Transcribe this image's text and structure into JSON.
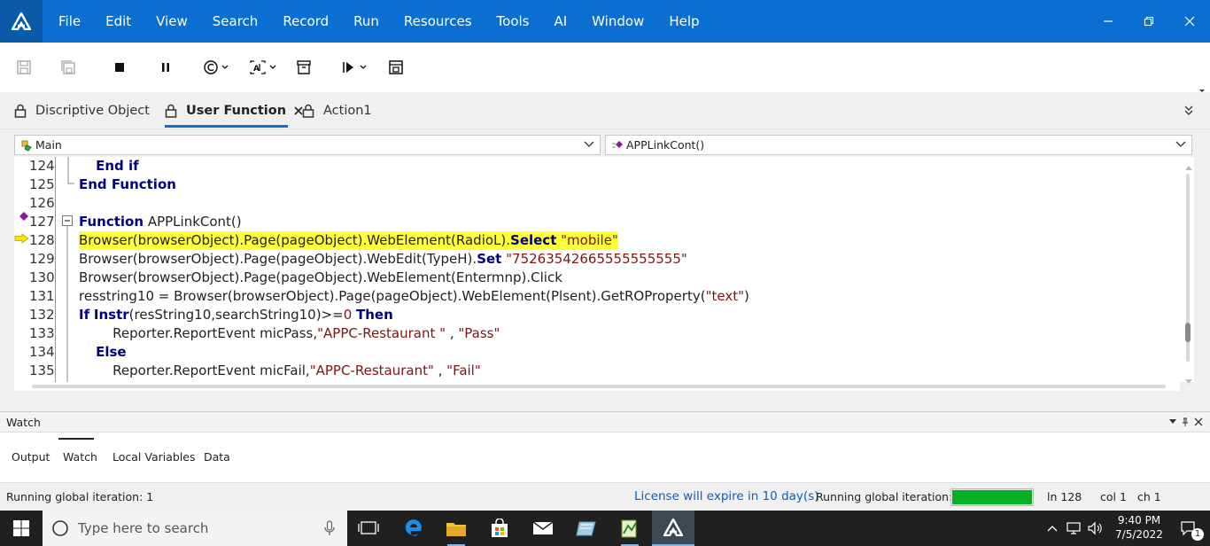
{
  "menubar": {
    "items": [
      "File",
      "Edit",
      "View",
      "Search",
      "Record",
      "Run",
      "Resources",
      "Tools",
      "AI",
      "Window",
      "Help"
    ]
  },
  "tabs": [
    {
      "label": "Discriptive Object"
    },
    {
      "label": "User Function",
      "active": true
    },
    {
      "label": "Action1"
    }
  ],
  "dropdowns": {
    "left": "Main",
    "right": "APPLinkCont()"
  },
  "code": {
    "lines": [
      {
        "num": "124",
        "segments": [
          {
            "t": "    "
          },
          {
            "t": "End if",
            "c": "kw"
          }
        ]
      },
      {
        "num": "125",
        "segments": [
          {
            "t": "End Function",
            "c": "kw"
          }
        ]
      },
      {
        "num": "126",
        "segments": []
      },
      {
        "num": "127",
        "segments": [
          {
            "t": "Function",
            "c": "kw"
          },
          {
            "t": " APPLinkCont()"
          }
        ]
      },
      {
        "num": "128",
        "highlight": true,
        "segments": [
          {
            "t": "Browser(browserObject).Page(pageObject).WebElement(RadioL)."
          },
          {
            "t": "Select",
            "c": "kw"
          },
          {
            "t": " "
          },
          {
            "t": "\"mobile\"",
            "c": "str"
          }
        ]
      },
      {
        "num": "129",
        "segments": [
          {
            "t": "Browser(browserObject).Page(pageObject).WebEdit(TypeH)."
          },
          {
            "t": "Set",
            "c": "kw"
          },
          {
            "t": " "
          },
          {
            "t": "\"75263542665555555555\"",
            "c": "str"
          }
        ]
      },
      {
        "num": "130",
        "segments": [
          {
            "t": "Browser(browserObject).Page(pageObject).WebElement(Entermnp).Click"
          }
        ]
      },
      {
        "num": "131",
        "segments": [
          {
            "t": "resstring10 = Browser(browserObject).Page(pageObject).WebElement(Plsent).GetROProperty("
          },
          {
            "t": "\"text\"",
            "c": "str"
          },
          {
            "t": ")"
          }
        ]
      },
      {
        "num": "132",
        "segments": [
          {
            "t": "If",
            "c": "kw"
          },
          {
            "t": " "
          },
          {
            "t": "Instr",
            "c": "kw"
          },
          {
            "t": "(resString10,searchString10)>="
          },
          {
            "t": "0",
            "c": "num"
          },
          {
            "t": " "
          },
          {
            "t": "Then",
            "c": "kw"
          }
        ]
      },
      {
        "num": "133",
        "segments": [
          {
            "t": "        Reporter.ReportEvent micPass,"
          },
          {
            "t": "\"APPC-Restaurant \"",
            "c": "str"
          },
          {
            "t": " , "
          },
          {
            "t": "\"Pass\"",
            "c": "str"
          }
        ]
      },
      {
        "num": "134",
        "segments": [
          {
            "t": "    "
          },
          {
            "t": "Else",
            "c": "kw"
          }
        ]
      },
      {
        "num": "135",
        "segments": [
          {
            "t": "        Reporter.ReportEvent micFail,"
          },
          {
            "t": "\"APPC-Restaurant\"",
            "c": "str"
          },
          {
            "t": " , "
          },
          {
            "t": "\"Fail\"",
            "c": "str"
          }
        ]
      }
    ]
  },
  "watch": {
    "title": "Watch",
    "tabs": [
      "Output",
      "Watch",
      "Local Variables",
      "Data"
    ],
    "active_tab": "Watch"
  },
  "status": {
    "left": "Running global iteration: 1",
    "license": "License will expire in 10 day(s)",
    "iteration": "Running global iteration: 1",
    "progress": 1.0,
    "ln": "ln 128",
    "col": "col 1",
    "ch": "ch 1"
  },
  "taskbar": {
    "search_placeholder": "Type here to search",
    "time": "9:40 PM",
    "date": "7/5/2022",
    "notifications": "1"
  },
  "colors": {
    "accent": "#0a6fd0",
    "highlight": "#ffff3a",
    "keyword": "#00007f",
    "string": "#7a1515",
    "progress": "#06b025"
  }
}
